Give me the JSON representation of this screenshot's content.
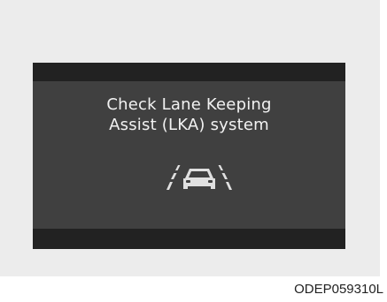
{
  "display": {
    "message_line1": "Check Lane Keeping",
    "message_line2": "Assist (LKA) system",
    "icon": "lka-warning-icon"
  },
  "caption": "ODEP059310L",
  "colors": {
    "background": "#ececec",
    "display": "#404040",
    "display_bars": "#222222",
    "text": "#f2f2f2"
  }
}
